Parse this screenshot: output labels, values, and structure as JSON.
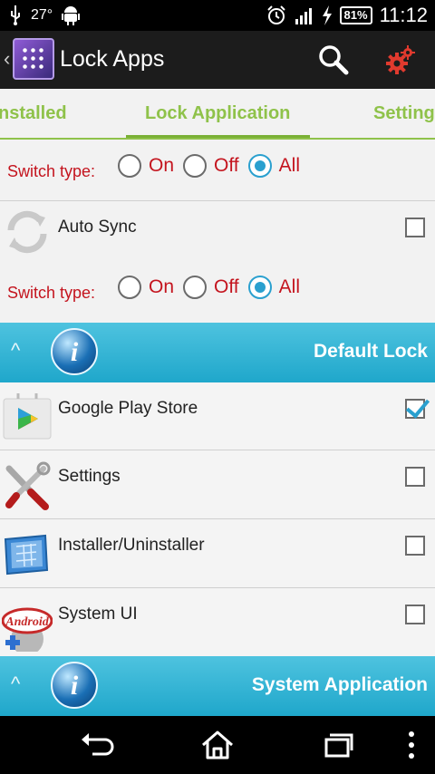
{
  "status_bar": {
    "temperature": "27°",
    "battery": "81%",
    "time": "11:12",
    "icons": [
      "usb-icon",
      "android-icon",
      "alarm-icon",
      "signal-icon",
      "charging-icon"
    ]
  },
  "action_bar": {
    "title": "Lock Apps",
    "icons": [
      "back-icon",
      "app-logo-icon",
      "search-icon",
      "gear-icon"
    ]
  },
  "tabs": [
    {
      "label": "nstalled"
    },
    {
      "label": "Lock Application",
      "active": true
    },
    {
      "label": "Setting"
    }
  ],
  "switch_type": {
    "label": "Switch type:",
    "options": [
      "On",
      "Off",
      "All"
    ],
    "selected": "All"
  },
  "auto_sync": {
    "label": "Auto Sync",
    "checked": false,
    "icon": "sync-icon"
  },
  "sections": [
    {
      "title": "Default Lock",
      "apps": [
        {
          "name": "Google Play Store",
          "checked": true,
          "icon": "play-store-icon"
        },
        {
          "name": "Settings",
          "checked": false,
          "icon": "settings-tools-icon"
        },
        {
          "name": "Installer/Uninstaller",
          "checked": false,
          "icon": "installer-icon"
        },
        {
          "name": "System UI",
          "checked": false,
          "icon": "android-system-icon"
        }
      ]
    },
    {
      "title": "System Application",
      "apps": []
    }
  ],
  "nav_bar": {
    "icons": [
      "back-nav-icon",
      "home-icon",
      "recents-icon",
      "menu-icon"
    ]
  },
  "colors": {
    "accent_green": "#8fc24a",
    "switch_red": "#c4141e",
    "header_blue": "#1fa7cb",
    "check_blue": "#2aa0cf"
  }
}
